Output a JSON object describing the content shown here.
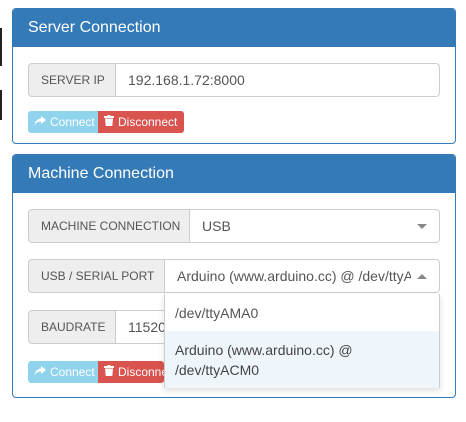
{
  "server_panel": {
    "title": "Server Connection",
    "ip_label": "SERVER IP",
    "ip_value": "192.168.1.72:8000",
    "connect_label": "Connect",
    "disconnect_label": "Disconnect"
  },
  "machine_panel": {
    "title": "Machine Connection",
    "connection_label": "MACHINE CONNECTION",
    "connection_value": "USB",
    "port_label": "USB / SERIAL PORT",
    "port_value": "Arduino (www.arduino.cc) @ /dev/ttyA...",
    "baud_label": "BAUDRATE",
    "baud_value": "11520",
    "connect_label": "Connect",
    "disconnect_label": "Disconne",
    "port_options": [
      {
        "label": "/dev/ttyAMA0"
      },
      {
        "label": "Arduino (www.arduino.cc) @ /dev/ttyACM0"
      }
    ]
  },
  "colors": {
    "primary": "#337ab7",
    "connect": "#8fd3ec",
    "disconnect": "#d9534f"
  },
  "icons": {
    "connect": "share-arrow-icon",
    "disconnect": "trash-icon"
  }
}
